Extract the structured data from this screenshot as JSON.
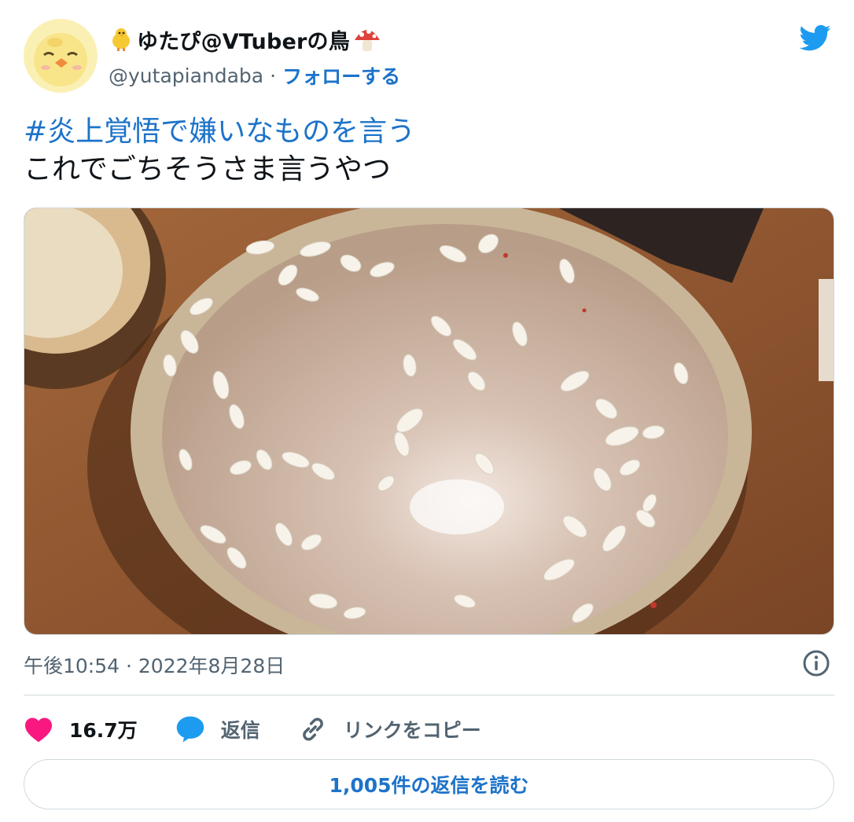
{
  "user": {
    "display_name": "ゆたぴ@VTuberの鳥",
    "handle": "@yutapiandaba",
    "separator": "·",
    "follow_label": "フォローする"
  },
  "tweet": {
    "hashtag": "#炎上覚悟で嫌いなものを言う",
    "text": "これでごちそうさま言うやつ",
    "timestamp": "午後10:54 · 2022年8月28日"
  },
  "actions": {
    "likes": "16.7万",
    "reply_label": "返信",
    "copy_link_label": "リンクをコピー"
  },
  "read_replies_label": "1,005件の返信を読む",
  "colors": {
    "accent": "#1d73c9",
    "like": "#f91880",
    "reply": "#1d9bf0",
    "muted": "#536471",
    "twitter_blue": "#1d9bf0"
  },
  "icons": [
    "chick-avatar-icon",
    "chick-emoji-icon",
    "mushroom-emoji-icon",
    "twitter-bird-icon",
    "info-icon",
    "heart-icon",
    "reply-bubble-icon",
    "link-icon"
  ]
}
